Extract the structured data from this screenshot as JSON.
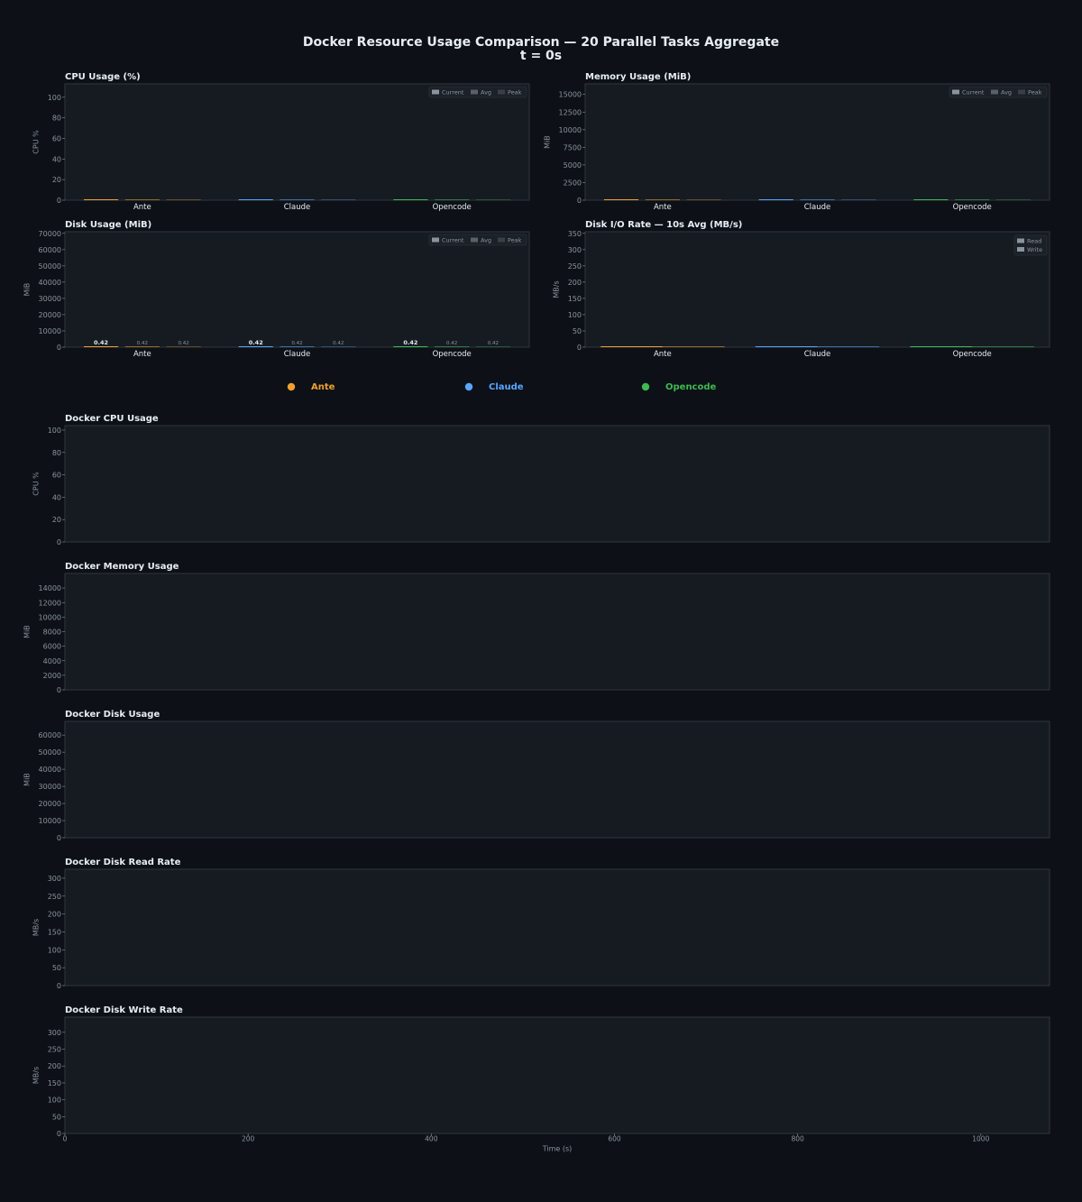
{
  "figure": {
    "title_line1": "Docker Resource Usage Comparison — 20 Parallel Tasks Aggregate",
    "title_line2": "t = 0s"
  },
  "colors": {
    "background": "#0d1117",
    "panel": "#161b22",
    "panel_border": "#30363d",
    "text": "#e6edf3",
    "muted_text": "#8b949e",
    "series": {
      "Ante": "#f0a030",
      "Claude": "#58a6ff",
      "Opencode": "#3fb950"
    },
    "legend_swatches": {
      "Current": "#8b949e",
      "Avg": "#5a6068",
      "Peak": "#3a3f46",
      "Read": "#8b949e",
      "Write": "#8b949e"
    }
  },
  "legend": {
    "items": [
      {
        "name": "Ante",
        "color": "#f0a030"
      },
      {
        "name": "Claude",
        "color": "#58a6ff"
      },
      {
        "name": "Opencode",
        "color": "#3fb950"
      }
    ]
  },
  "chart_data": [
    {
      "id": "cpu_bar",
      "type": "bar",
      "title": "CPU Usage (%)",
      "ylabel": "CPU %",
      "categories": [
        "Ante",
        "Claude",
        "Opencode"
      ],
      "ylim": [
        0,
        113
      ],
      "yticks": [
        "0",
        "20",
        "40",
        "60",
        "80",
        "100"
      ],
      "legend": {
        "position": "upper right",
        "entries": [
          "Current",
          "Avg",
          "Peak"
        ]
      },
      "series": [
        {
          "name": "Current",
          "values": [
            0,
            0,
            0
          ]
        },
        {
          "name": "Avg",
          "values": [
            0,
            0,
            0
          ]
        },
        {
          "name": "Peak",
          "values": [
            0,
            0,
            0
          ]
        }
      ]
    },
    {
      "id": "mem_bar",
      "type": "bar",
      "title": "Memory Usage (MiB)",
      "ylabel": "MiB",
      "categories": [
        "Ante",
        "Claude",
        "Opencode"
      ],
      "ylim": [
        0,
        16500
      ],
      "yticks": [
        "0",
        "2500",
        "5000",
        "7500",
        "10000",
        "12500",
        "15000"
      ],
      "legend": {
        "position": "upper right",
        "entries": [
          "Current",
          "Avg",
          "Peak"
        ]
      },
      "series": [
        {
          "name": "Current",
          "values": [
            0,
            0,
            0
          ]
        },
        {
          "name": "Avg",
          "values": [
            0,
            0,
            0
          ]
        },
        {
          "name": "Peak",
          "values": [
            0,
            0,
            0
          ]
        }
      ]
    },
    {
      "id": "disk_bar",
      "type": "bar",
      "title": "Disk Usage (MiB)",
      "ylabel": "MiB",
      "categories": [
        "Ante",
        "Claude",
        "Opencode"
      ],
      "ylim": [
        0,
        71000
      ],
      "yticks": [
        "0",
        "10000",
        "20000",
        "30000",
        "40000",
        "50000",
        "60000",
        "70000"
      ],
      "legend": {
        "position": "upper right",
        "entries": [
          "Current",
          "Avg",
          "Peak"
        ]
      },
      "series": [
        {
          "name": "Current",
          "values": [
            0.42,
            0.42,
            0.42
          ],
          "labels": [
            "0.42",
            "0.42",
            "0.42"
          ]
        },
        {
          "name": "Avg",
          "values": [
            0.42,
            0.42,
            0.42
          ],
          "labels": [
            "0.42",
            "0.42",
            "0.42"
          ]
        },
        {
          "name": "Peak",
          "values": [
            0.42,
            0.42,
            0.42
          ],
          "labels": [
            "0.42",
            "0.42",
            "0.42"
          ]
        }
      ]
    },
    {
      "id": "io_bar",
      "type": "bar",
      "title": "Disk I/O Rate — 10s Avg (MB/s)",
      "ylabel": "MB/s",
      "categories": [
        "Ante",
        "Claude",
        "Opencode"
      ],
      "ylim": [
        0,
        355
      ],
      "yticks": [
        "0",
        "50",
        "100",
        "150",
        "200",
        "250",
        "300",
        "350"
      ],
      "legend": {
        "position": "upper right",
        "entries": [
          "Read",
          "Write"
        ]
      },
      "series": [
        {
          "name": "Read",
          "values": [
            0,
            0,
            0
          ]
        },
        {
          "name": "Write",
          "values": [
            0,
            0,
            0
          ]
        }
      ]
    },
    {
      "id": "cpu_ts",
      "type": "line",
      "title": "Docker CPU Usage",
      "ylabel": "CPU %",
      "xlim": [
        0,
        1075
      ],
      "ylim": [
        0,
        104
      ],
      "yticks": [
        "0",
        "20",
        "40",
        "60",
        "80",
        "100"
      ],
      "series": []
    },
    {
      "id": "mem_ts",
      "type": "line",
      "title": "Docker Memory Usage",
      "ylabel": "MiB",
      "xlim": [
        0,
        1075
      ],
      "ylim": [
        0,
        16000
      ],
      "yticks": [
        "0",
        "2000",
        "4000",
        "6000",
        "8000",
        "10000",
        "12000",
        "14000"
      ],
      "series": []
    },
    {
      "id": "disk_ts",
      "type": "line",
      "title": "Docker Disk Usage",
      "ylabel": "MiB",
      "xlim": [
        0,
        1075
      ],
      "ylim": [
        0,
        68000
      ],
      "yticks": [
        "0",
        "10000",
        "20000",
        "30000",
        "40000",
        "50000",
        "60000"
      ],
      "series": []
    },
    {
      "id": "read_ts",
      "type": "line",
      "title": "Docker Disk Read Rate",
      "ylabel": "MB/s",
      "xlim": [
        0,
        1075
      ],
      "ylim": [
        0,
        325
      ],
      "yticks": [
        "0",
        "50",
        "100",
        "150",
        "200",
        "250",
        "300"
      ],
      "series": []
    },
    {
      "id": "write_ts",
      "type": "line",
      "title": "Docker Disk Write Rate",
      "ylabel": "MB/s",
      "xlabel": "Time (s)",
      "xlim": [
        0,
        1075
      ],
      "ylim": [
        0,
        345
      ],
      "xticks": [
        "0",
        "200",
        "400",
        "600",
        "800",
        "1000"
      ],
      "yticks": [
        "0",
        "50",
        "100",
        "150",
        "200",
        "250",
        "300"
      ],
      "series": []
    }
  ]
}
